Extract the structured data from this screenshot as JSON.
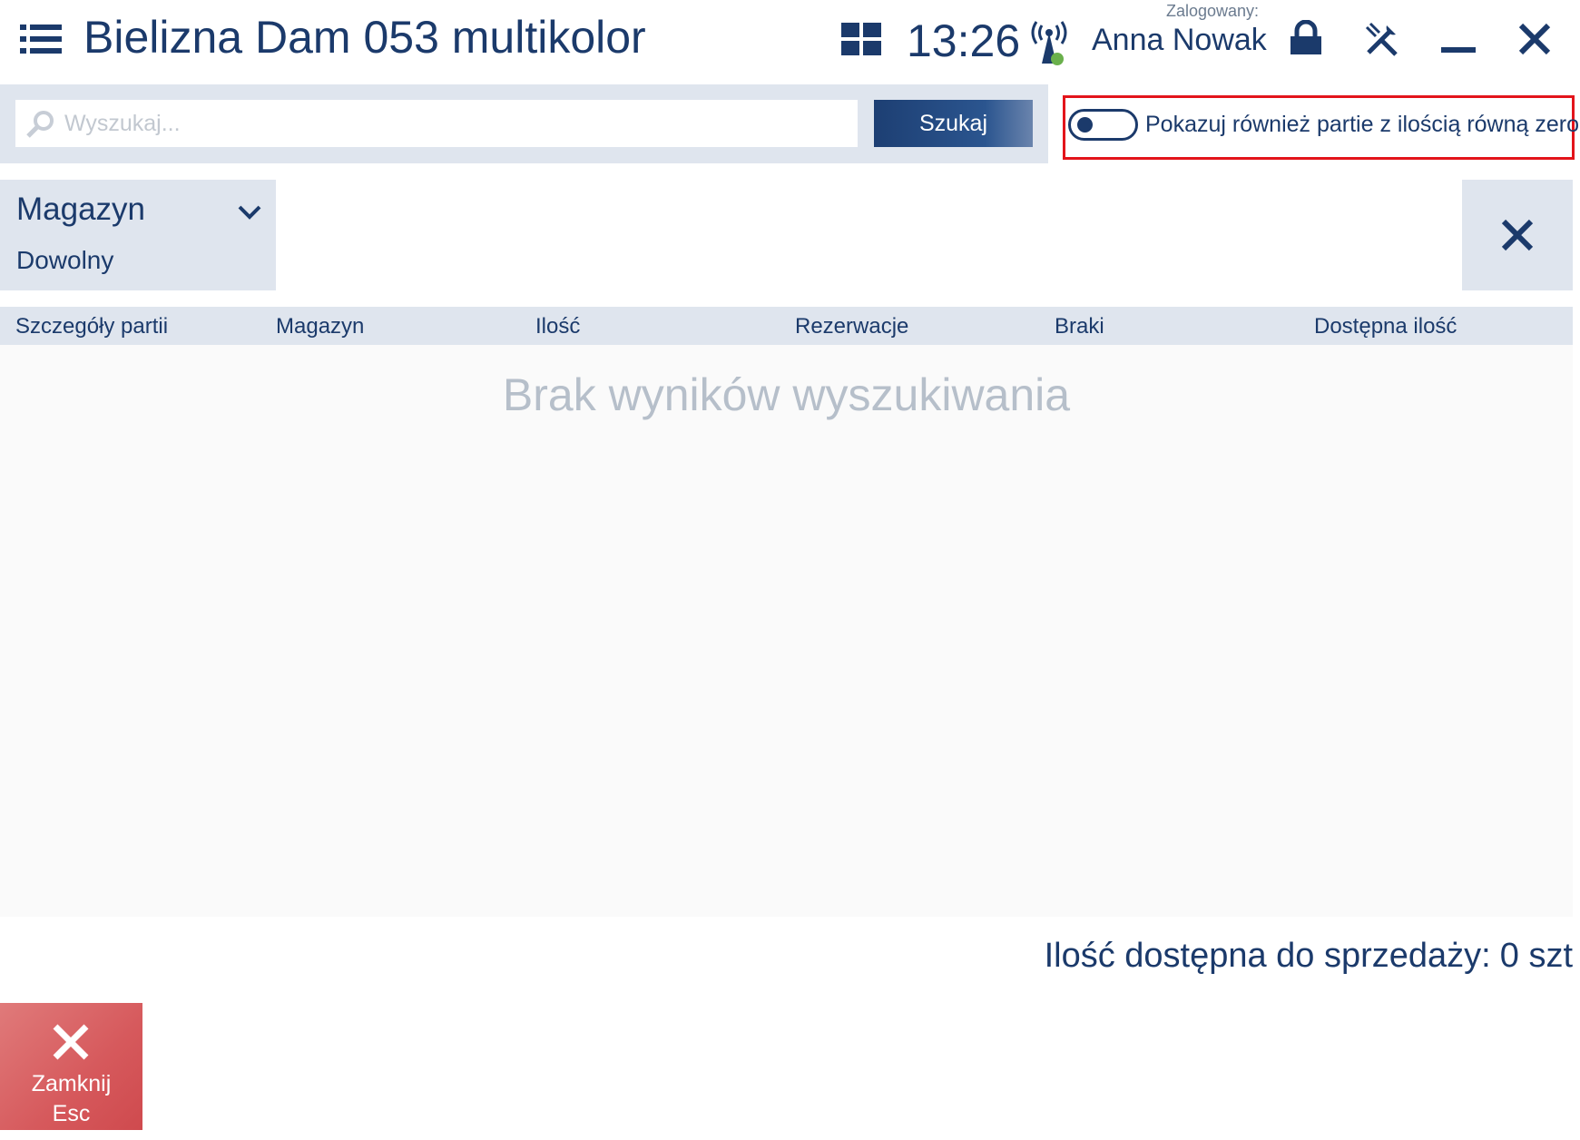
{
  "header": {
    "title": "Bielizna Dam 053 multikolor",
    "time": "13:26",
    "logged_label": "Zalogowany:",
    "user_name": "Anna Nowak",
    "icons": [
      "menu-icon",
      "tiles-icon",
      "signal-icon",
      "lock-icon",
      "tools-icon",
      "minimize-icon",
      "close-icon"
    ]
  },
  "search": {
    "placeholder": "Wyszukaj...",
    "value": "",
    "button_label": "Szukaj"
  },
  "option": {
    "label": "Pokazuj również partie z ilością równą zero",
    "enabled": false
  },
  "filter": {
    "title": "Magazyn",
    "value": "Dowolny"
  },
  "table": {
    "columns": [
      "Szczegóły partii",
      "Magazyn",
      "Ilość",
      "Rezerwacje",
      "Braki",
      "Dostępna ilość"
    ],
    "rows": [],
    "empty_message": "Brak wyników wyszukiwania"
  },
  "summary": {
    "label": "Ilość dostępna do sprzedaży:",
    "value": "0 szt"
  },
  "footer": {
    "close_label": "Zamknij",
    "close_key": "Esc"
  },
  "colors": {
    "primary": "#1b3a6b",
    "panel": "#dfe5ee",
    "highlight": "#e3141b",
    "close_button": "#d6595c",
    "status_online": "#6ab04c"
  }
}
